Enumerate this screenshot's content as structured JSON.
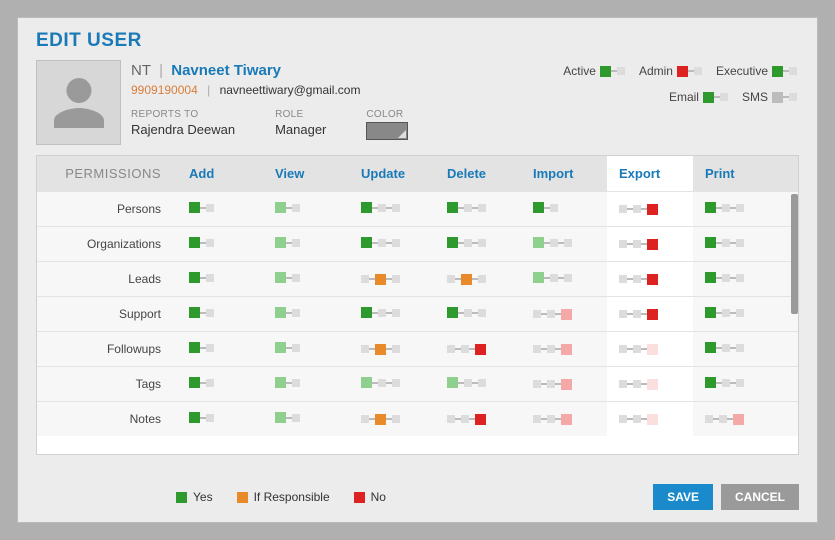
{
  "title": "EDIT USER",
  "user": {
    "initials": "NT",
    "name": "Navneet Tiwary",
    "phone": "9909190004",
    "email": "navneettiwary@gmail.com",
    "reports_to_label": "REPORTS TO",
    "reports_to": "Rajendra Deewan",
    "role_label": "ROLE",
    "role": "Manager",
    "color_label": "COLOR"
  },
  "flags_row1": [
    {
      "label": "Active",
      "state": "green"
    },
    {
      "label": "Admin",
      "state": "red"
    },
    {
      "label": "Executive",
      "state": "green"
    }
  ],
  "flags_row2": [
    {
      "label": "Email",
      "state": "green"
    },
    {
      "label": "SMS",
      "state": "gray"
    }
  ],
  "perm_header_first": "PERMISSIONS",
  "perm_cols": [
    "Add",
    "View",
    "Update",
    "Delete",
    "Import",
    "Export",
    "Print"
  ],
  "perm_rows": [
    {
      "label": "Persons",
      "cells": [
        "g",
        "lg",
        "g3",
        "g3",
        "g",
        "red3",
        "g3"
      ]
    },
    {
      "label": "Organizations",
      "cells": [
        "g",
        "lg",
        "g3",
        "g3",
        "lg3",
        "red3",
        "g3"
      ]
    },
    {
      "label": "Leads",
      "cells": [
        "g",
        "lg",
        "o3",
        "o3",
        "lg3",
        "red3",
        "g3"
      ]
    },
    {
      "label": "Support",
      "cells": [
        "g",
        "lg",
        "g3",
        "g3",
        "pk3",
        "red3",
        "g3"
      ]
    },
    {
      "label": "Followups",
      "cells": [
        "g",
        "lg",
        "o3",
        "r3",
        "pk3",
        "vpk3",
        "g3"
      ]
    },
    {
      "label": "Tags",
      "cells": [
        "g",
        "lg",
        "lg3",
        "lg3",
        "pk3",
        "vpk3",
        "g3"
      ]
    },
    {
      "label": "Notes",
      "cells": [
        "g",
        "lg",
        "o3",
        "r3",
        "pk3",
        "vpk3",
        "pk3"
      ]
    }
  ],
  "legend": {
    "yes": "Yes",
    "if_responsible": "If Responsible",
    "no": "No"
  },
  "buttons": {
    "save": "SAVE",
    "cancel": "CANCEL"
  }
}
